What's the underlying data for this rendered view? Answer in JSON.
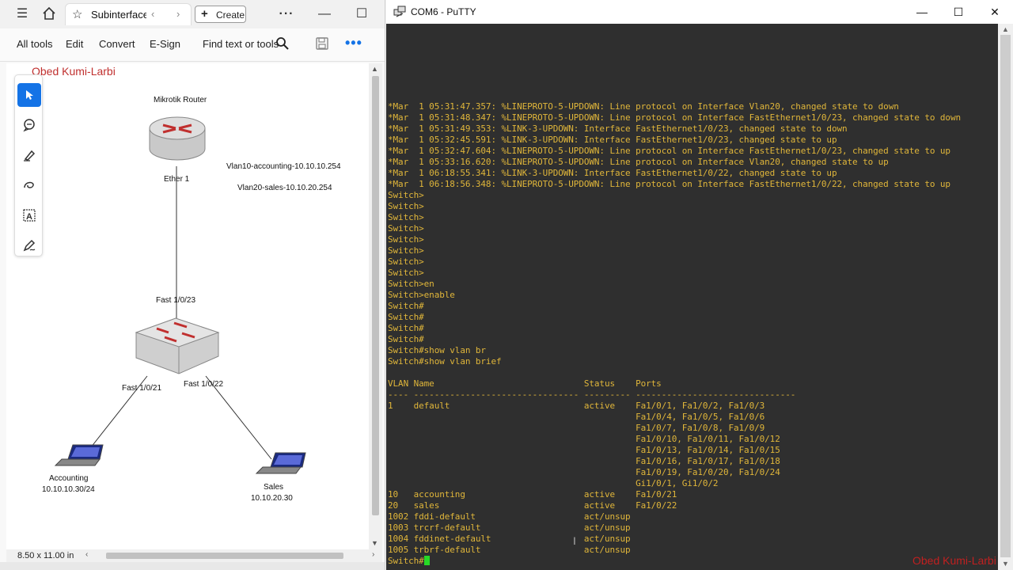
{
  "pdf_viewer": {
    "tab_title": "Subinterface",
    "create_label": "Create",
    "menu": [
      "All tools",
      "Edit",
      "Convert",
      "E-Sign",
      "Find text or tools"
    ],
    "page_size": "8.50 x 11.00 in",
    "author": "Obed Kumi-Larbi",
    "diagram": {
      "router_title": "Mikrotik Router",
      "router_port": "Ether 1",
      "vlan10": "Vlan10-accounting-10.10.10.254",
      "vlan20": "Vlan20-sales-10.10.20.254",
      "switch_uplink": "Fast 1/0/23",
      "switch_left": "Fast 1/0/21",
      "switch_right": "Fast 1/0/22",
      "pc1_name": "Accounting",
      "pc1_ip": "10.10.10.30/24",
      "pc2_name": "Sales",
      "pc2_ip": "10.10.20.30"
    }
  },
  "putty": {
    "title": "COM6 - PuTTY",
    "terminal_lines": [
      "*Mar  1 05:31:47.357: %LINEPROTO-5-UPDOWN: Line protocol on Interface Vlan20, changed state to down",
      "*Mar  1 05:31:48.347: %LINEPROTO-5-UPDOWN: Line protocol on Interface FastEthernet1/0/23, changed state to down",
      "*Mar  1 05:31:49.353: %LINK-3-UPDOWN: Interface FastEthernet1/0/23, changed state to down",
      "*Mar  1 05:32:45.591: %LINK-3-UPDOWN: Interface FastEthernet1/0/23, changed state to up",
      "*Mar  1 05:32:47.604: %LINEPROTO-5-UPDOWN: Line protocol on Interface FastEthernet1/0/23, changed state to up",
      "*Mar  1 05:33:16.620: %LINEPROTO-5-UPDOWN: Line protocol on Interface Vlan20, changed state to up",
      "*Mar  1 06:18:55.341: %LINK-3-UPDOWN: Interface FastEthernet1/0/22, changed state to up",
      "*Mar  1 06:18:56.348: %LINEPROTO-5-UPDOWN: Line protocol on Interface FastEthernet1/0/22, changed state to up",
      "Switch>",
      "Switch>",
      "Switch>",
      "Switch>",
      "Switch>",
      "Switch>",
      "Switch>",
      "Switch>",
      "Switch>en",
      "Switch>enable",
      "Switch#",
      "Switch#",
      "Switch#",
      "Switch#",
      "Switch#show vlan br",
      "Switch#show vlan brief",
      "",
      "VLAN Name                             Status    Ports",
      "---- -------------------------------- --------- -------------------------------",
      "1    default                          active    Fa1/0/1, Fa1/0/2, Fa1/0/3",
      "                                                Fa1/0/4, Fa1/0/5, Fa1/0/6",
      "                                                Fa1/0/7, Fa1/0/8, Fa1/0/9",
      "                                                Fa1/0/10, Fa1/0/11, Fa1/0/12",
      "                                                Fa1/0/13, Fa1/0/14, Fa1/0/15",
      "                                                Fa1/0/16, Fa1/0/17, Fa1/0/18",
      "                                                Fa1/0/19, Fa1/0/20, Fa1/0/24",
      "                                                Gi1/0/1, Gi1/0/2",
      "10   accounting                       active    Fa1/0/21",
      "20   sales                            active    Fa1/0/22",
      "1002 fddi-default                     act/unsup",
      "1003 trcrf-default                    act/unsup",
      "1004 fddinet-default                  act/unsup",
      "1005 trbrf-default                    act/unsup"
    ],
    "prompt": "Switch#",
    "watermark": "Obed Kumi-Larbi"
  },
  "colors": {
    "terminal_bg": "#2f2f2f",
    "terminal_text": "#e0b63a",
    "cursor": "#26d926",
    "accent": "#1473e6",
    "author_red": "#c0302f"
  }
}
